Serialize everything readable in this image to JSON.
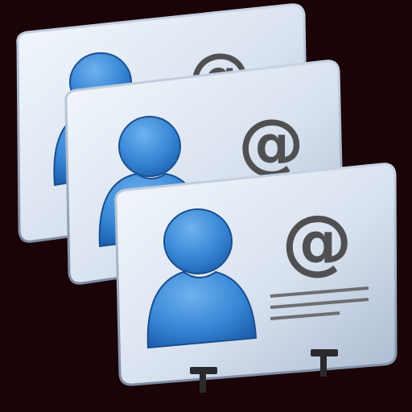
{
  "icon": {
    "name": "contact-cards-stack-icon",
    "description_glyph": "@"
  },
  "palette": {
    "background": "#1a0408",
    "card_face_light": "#eef3fa",
    "card_face_dark": "#b4c3d8",
    "card_edge": "#8a99b0",
    "person_fill_light": "#4f9be0",
    "person_fill_dark": "#1d63b8",
    "person_stroke": "#1a4f90",
    "glyph_color": "#505052",
    "line_color": "#6e6e70"
  },
  "cards": [
    {
      "name": "back-card",
      "at_label": "@"
    },
    {
      "name": "middle-card",
      "at_label": "@"
    },
    {
      "name": "front-card",
      "at_label": "@"
    }
  ]
}
